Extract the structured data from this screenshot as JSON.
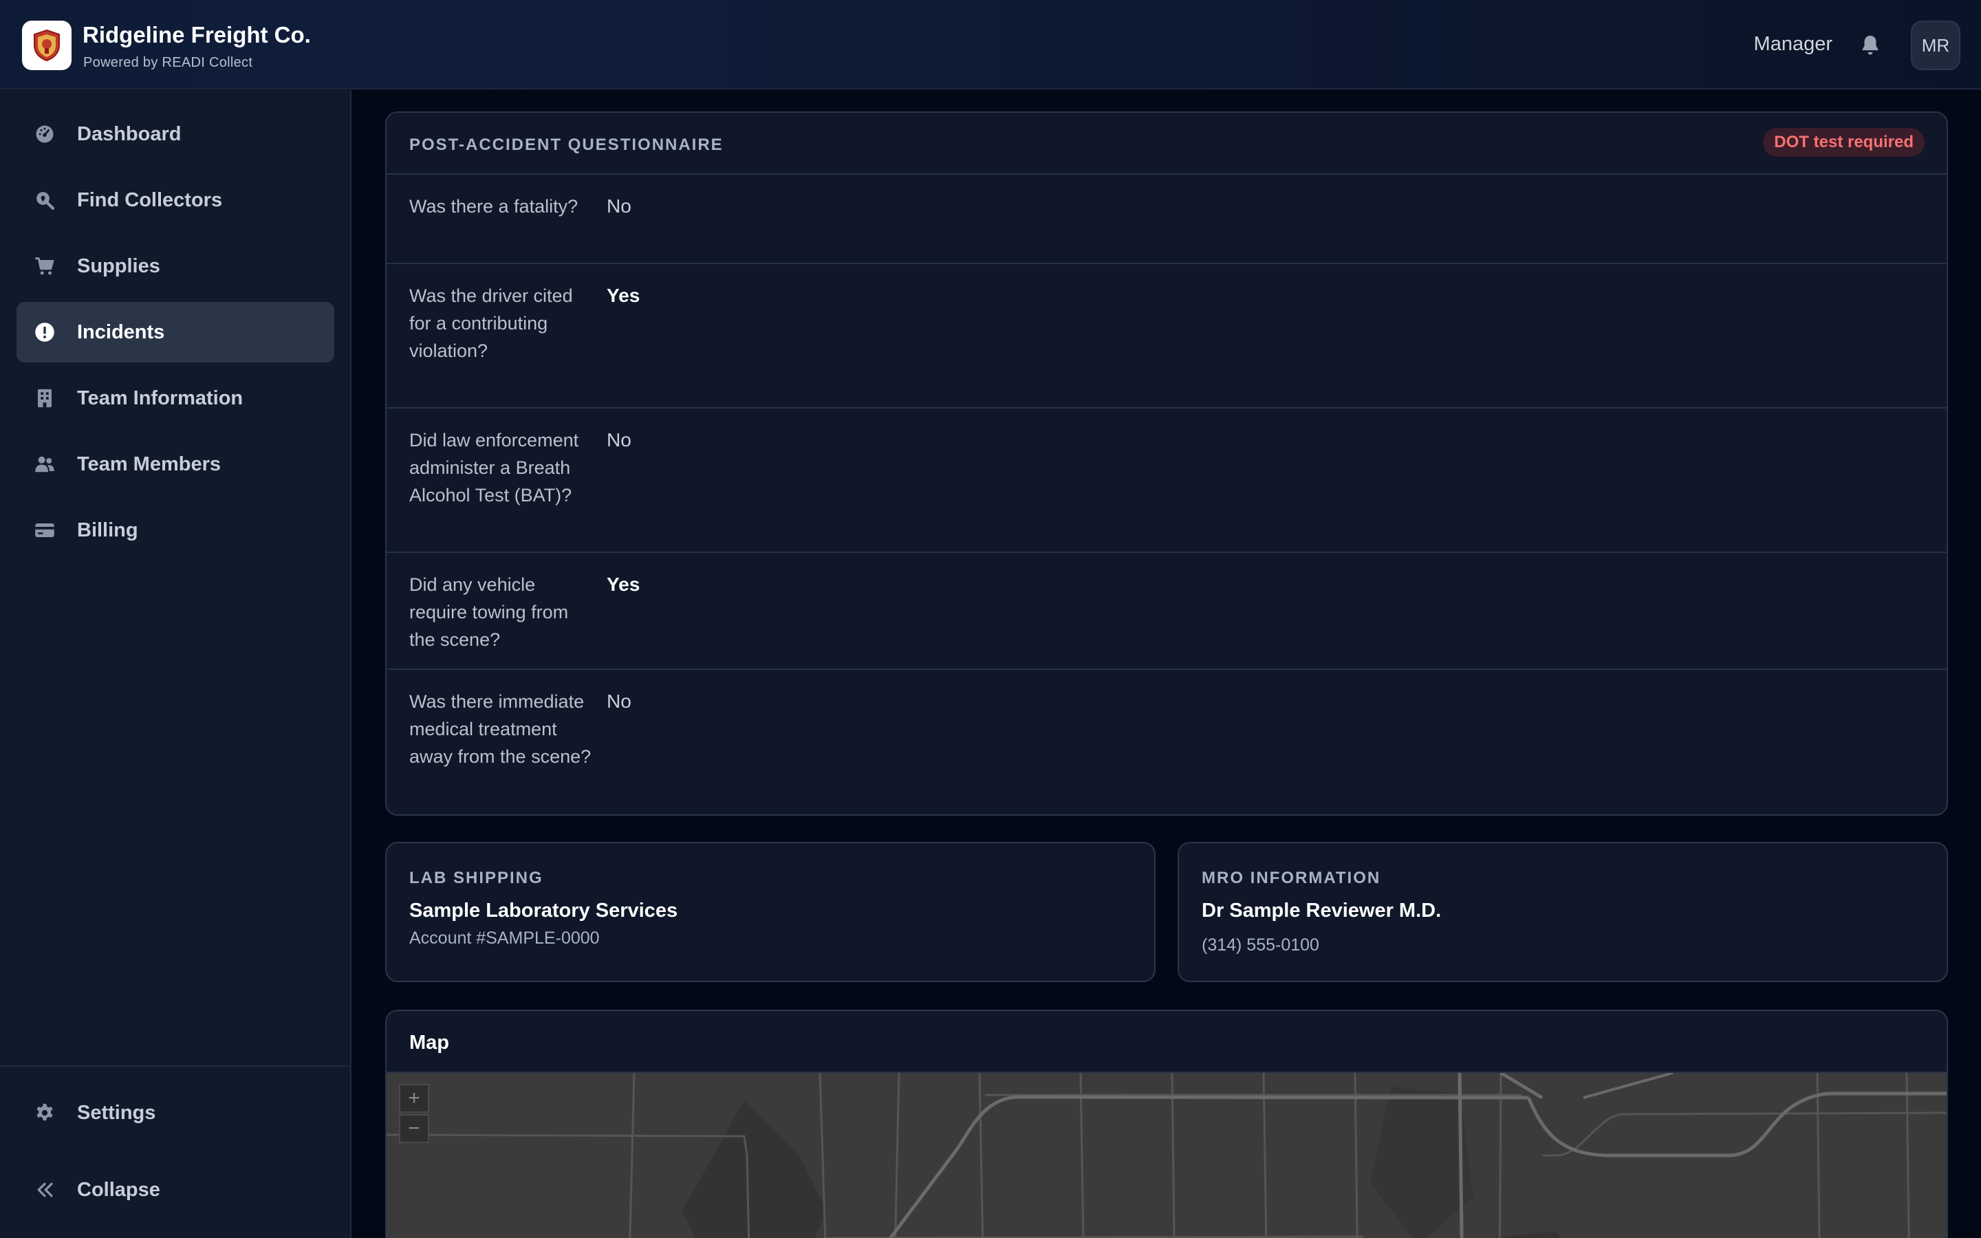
{
  "header": {
    "brand_name": "Ridgeline Freight Co.",
    "brand_sub": "Powered by READI Collect",
    "role": "Manager",
    "avatar_initials": "MR"
  },
  "sidebar": {
    "items": [
      {
        "label": "Dashboard",
        "icon": "dashboard-gauge-icon"
      },
      {
        "label": "Find Collectors",
        "icon": "search-location-icon"
      },
      {
        "label": "Supplies",
        "icon": "cart-icon"
      },
      {
        "label": "Incidents",
        "icon": "alert-circle-icon",
        "active": true
      },
      {
        "label": "Team Information",
        "icon": "building-icon"
      },
      {
        "label": "Team Members",
        "icon": "users-icon"
      },
      {
        "label": "Billing",
        "icon": "credit-card-icon"
      }
    ],
    "settings_label": "Settings",
    "collapse_label": "Collapse"
  },
  "questionnaire": {
    "title": "POST-ACCIDENT QUESTIONNAIRE",
    "badge": "DOT test required",
    "rows": [
      {
        "question": "Was there a fatality?",
        "answer": "No"
      },
      {
        "question": "Was the driver cited for a contributing violation?",
        "answer": "Yes"
      },
      {
        "question": "Did law enforcement administer a Breath Alcohol Test (BAT)?",
        "answer": "No"
      },
      {
        "question": "Did any vehicle require towing from the scene?",
        "answer": "Yes"
      },
      {
        "question": "Was there immediate medical treatment away from the scene?",
        "answer": "No"
      }
    ]
  },
  "lab_shipping": {
    "label": "LAB SHIPPING",
    "name": "Sample Laboratory Services",
    "account": "Account #SAMPLE-0000"
  },
  "mro": {
    "label": "MRO INFORMATION",
    "name": "Dr Sample Reviewer M.D.",
    "phone": "(314) 555-0100"
  },
  "map": {
    "title": "Map",
    "zoom_in": "+",
    "zoom_out": "−"
  },
  "colors": {
    "accent_badge": "#f87171",
    "active_nav": "#2a3548",
    "card_bg": "#0f1729"
  }
}
